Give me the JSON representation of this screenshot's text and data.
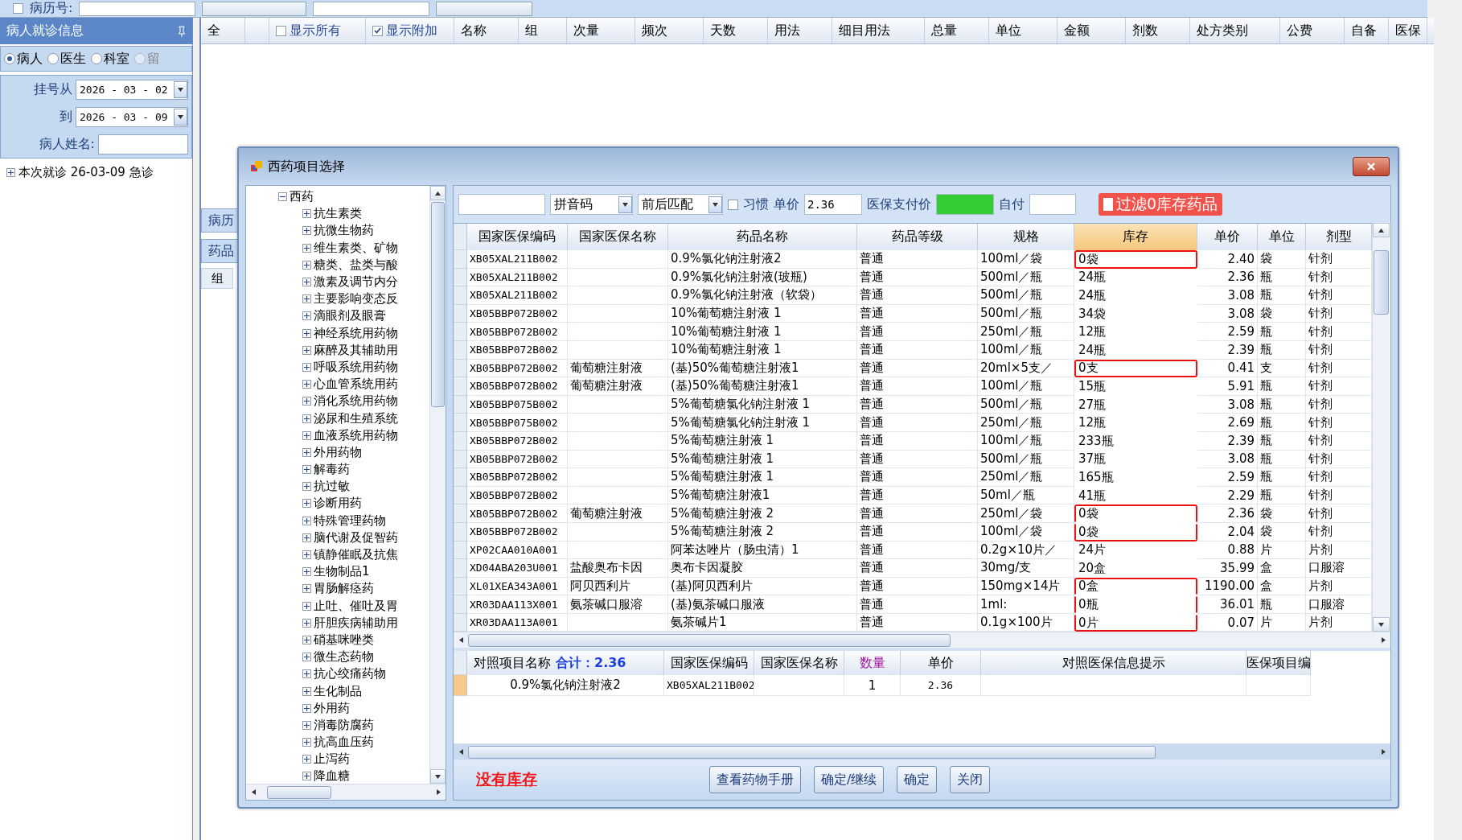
{
  "top_bar": {
    "record_checkbox": {
      "checked": false
    },
    "record_label": "病历号:"
  },
  "left_panel": {
    "title": "病人就诊信息",
    "filters": [
      {
        "label": "病人",
        "selected": true,
        "disabled": false
      },
      {
        "label": "医生",
        "selected": false,
        "disabled": false
      },
      {
        "label": "科室",
        "selected": false,
        "disabled": false
      },
      {
        "label": "留",
        "selected": false,
        "disabled": true
      }
    ],
    "date_from_label": "挂号从",
    "date_from": "2026 - 03 - 02",
    "date_to_label": "到",
    "date_to": "2026 - 03 - 09",
    "name_label": "病人姓名:",
    "visits": [
      {
        "label": "本次就诊 26-03-09 急诊",
        "expanded": false
      }
    ]
  },
  "order_grid": {
    "columns": [
      {
        "kind": "text",
        "label": "全"
      },
      {
        "kind": "blank"
      },
      {
        "kind": "check",
        "label": "显示所有",
        "checked": false
      },
      {
        "kind": "check",
        "label": "显示附加",
        "checked": true
      },
      {
        "kind": "text",
        "label": "名称"
      },
      {
        "kind": "text",
        "label": "组"
      },
      {
        "kind": "text",
        "label": "次量"
      },
      {
        "kind": "text",
        "label": "频次"
      },
      {
        "kind": "text",
        "label": "天数"
      },
      {
        "kind": "text",
        "label": "用法"
      },
      {
        "kind": "text",
        "label": "细目用法"
      },
      {
        "kind": "text",
        "label": "总量"
      },
      {
        "kind": "text",
        "label": "单位"
      },
      {
        "kind": "text",
        "label": "金额"
      },
      {
        "kind": "text",
        "label": "剂数"
      },
      {
        "kind": "text",
        "label": "处方类别"
      },
      {
        "kind": "text",
        "label": "公费"
      },
      {
        "kind": "text",
        "label": "自备"
      },
      {
        "kind": "text",
        "label": "医保"
      }
    ],
    "tabs": [
      "病历",
      "药品"
    ],
    "subgrid_column": "组"
  },
  "dialog": {
    "title": "西药项目选择",
    "tree": {
      "label": "西药",
      "expanded": true,
      "children": [
        {
          "label": "抗生素类",
          "expanded": false
        },
        {
          "label": "抗微生物药",
          "expanded": false
        },
        {
          "label": "维生素类、矿物",
          "expanded": false
        },
        {
          "label": "糖类、盐类与酸",
          "expanded": false
        },
        {
          "label": "激素及调节内分",
          "expanded": false
        },
        {
          "label": "主要影响变态反",
          "expanded": false
        },
        {
          "label": "滴眼剂及眼膏",
          "expanded": false
        },
        {
          "label": "神经系统用药物",
          "expanded": false
        },
        {
          "label": "麻醉及其辅助用",
          "expanded": false
        },
        {
          "label": "呼吸系统用药物",
          "expanded": false
        },
        {
          "label": "心血管系统用药",
          "expanded": false
        },
        {
          "label": "消化系统用药物",
          "expanded": false
        },
        {
          "label": "泌尿和生殖系统",
          "expanded": false
        },
        {
          "label": "血液系统用药物",
          "expanded": false
        },
        {
          "label": "外用药物",
          "expanded": false
        },
        {
          "label": "解毒药",
          "expanded": false
        },
        {
          "label": "抗过敏",
          "expanded": false
        },
        {
          "label": "诊断用药",
          "expanded": false
        },
        {
          "label": "特殊管理药物",
          "expanded": false
        },
        {
          "label": "脑代谢及促智药",
          "expanded": false
        },
        {
          "label": "镇静催眠及抗焦",
          "expanded": false
        },
        {
          "label": "生物制品1",
          "expanded": false
        },
        {
          "label": "胃肠解痉药",
          "expanded": false
        },
        {
          "label": "止吐、催吐及胃",
          "expanded": false
        },
        {
          "label": "肝胆疾病辅助用",
          "expanded": false
        },
        {
          "label": "硝基咪唑类",
          "expanded": false
        },
        {
          "label": "微生态药物",
          "expanded": false
        },
        {
          "label": "抗心绞痛药物",
          "expanded": false
        },
        {
          "label": "生化制品",
          "expanded": false
        },
        {
          "label": "外用药",
          "expanded": false
        },
        {
          "label": "消毒防腐药",
          "expanded": false
        },
        {
          "label": "抗高血压药",
          "expanded": false
        },
        {
          "label": "止泻药",
          "expanded": false
        },
        {
          "label": "降血糖",
          "expanded": false
        }
      ]
    },
    "toolbar": {
      "code_type": "拼音码",
      "match_mode": "前后匹配",
      "habit": {
        "label": "习惯",
        "checked": false
      },
      "price_label": "单价",
      "price": "2.36",
      "insurance_price_label": "医保支付价",
      "self_pay_label": "自付",
      "filter_zero_stock": {
        "label": "过滤0库存药品",
        "checked": false
      }
    },
    "table": {
      "columns": [
        {
          "label": "国家医保编码",
          "sorted": false
        },
        {
          "label": "国家医保名称",
          "sorted": false
        },
        {
          "label": "药品名称",
          "sorted": false
        },
        {
          "label": "药品等级",
          "sorted": false
        },
        {
          "label": "规格",
          "sorted": false
        },
        {
          "label": "库存",
          "sorted": true
        },
        {
          "label": "单价",
          "sorted": false
        },
        {
          "label": "单位",
          "sorted": false
        },
        {
          "label": "剂型",
          "sorted": false
        }
      ],
      "rows": [
        {
          "highlighted": true,
          "cells": [
            "XB05XAL211B002",
            "",
            "0.9%氯化钠注射液2",
            "普通",
            "100ml／袋",
            "0袋",
            "2.40",
            "袋",
            "针剂"
          ]
        },
        {
          "highlighted": false,
          "cells": [
            "XB05XAL211B002",
            "",
            "0.9%氯化钠注射液(玻瓶)",
            "普通",
            "500ml／瓶",
            "24瓶",
            "2.36",
            "瓶",
            "针剂"
          ]
        },
        {
          "highlighted": false,
          "cells": [
            "XB05XAL211B002",
            "",
            "0.9%氯化钠注射液（软袋）",
            "普通",
            "500ml／瓶",
            "24瓶",
            "3.08",
            "瓶",
            "针剂"
          ]
        },
        {
          "highlighted": false,
          "cells": [
            "XB05BBP072B002",
            "",
            "10%葡萄糖注射液 1",
            "普通",
            "500ml／瓶",
            "34袋",
            "3.08",
            "袋",
            "针剂"
          ]
        },
        {
          "highlighted": false,
          "cells": [
            "XB05BBP072B002",
            "",
            "10%葡萄糖注射液 1",
            "普通",
            "250ml／瓶",
            "12瓶",
            "2.59",
            "瓶",
            "针剂"
          ]
        },
        {
          "highlighted": false,
          "cells": [
            "XB05BBP072B002",
            "",
            "10%葡萄糖注射液 1",
            "普通",
            "100ml／瓶",
            "24瓶",
            "2.39",
            "瓶",
            "针剂"
          ]
        },
        {
          "highlighted": true,
          "cells": [
            "XB05BBP072B002",
            "葡萄糖注射液",
            "(基)50%葡萄糖注射液1",
            "普通",
            "20ml×5支／",
            "0支",
            "0.41",
            "支",
            "针剂"
          ]
        },
        {
          "highlighted": false,
          "cells": [
            "XB05BBP072B002",
            "葡萄糖注射液",
            "(基)50%葡萄糖注射液1",
            "普通",
            "100ml／瓶",
            "15瓶",
            "5.91",
            "瓶",
            "针剂"
          ]
        },
        {
          "highlighted": false,
          "cells": [
            "XB05BBP075B002",
            "",
            "5%葡萄糖氯化钠注射液 1",
            "普通",
            "500ml／瓶",
            "27瓶",
            "3.08",
            "瓶",
            "针剂"
          ]
        },
        {
          "highlighted": false,
          "cells": [
            "XB05BBP075B002",
            "",
            "5%葡萄糖氯化钠注射液 1",
            "普通",
            "250ml／瓶",
            "12瓶",
            "2.69",
            "瓶",
            "针剂"
          ]
        },
        {
          "highlighted": false,
          "cells": [
            "XB05BBP072B002",
            "",
            "5%葡萄糖注射液 1",
            "普通",
            "100ml／瓶",
            "233瓶",
            "2.39",
            "瓶",
            "针剂"
          ]
        },
        {
          "highlighted": false,
          "cells": [
            "XB05BBP072B002",
            "",
            "5%葡萄糖注射液 1",
            "普通",
            "500ml／瓶",
            "37瓶",
            "3.08",
            "瓶",
            "针剂"
          ]
        },
        {
          "highlighted": false,
          "cells": [
            "XB05BBP072B002",
            "",
            "5%葡萄糖注射液 1",
            "普通",
            "250ml／瓶",
            "165瓶",
            "2.59",
            "瓶",
            "针剂"
          ]
        },
        {
          "highlighted": false,
          "cells": [
            "XB05BBP072B002",
            "",
            "5%葡萄糖注射液1",
            "普通",
            "50ml／瓶",
            "41瓶",
            "2.29",
            "瓶",
            "针剂"
          ]
        },
        {
          "highlighted": true,
          "cells": [
            "XB05BBP072B002",
            "葡萄糖注射液",
            "5%葡萄糖注射液 2",
            "普通",
            "250ml／袋",
            "0袋",
            "2.36",
            "袋",
            "针剂"
          ]
        },
        {
          "highlighted": true,
          "cells": [
            "XB05BBP072B002",
            "",
            "5%葡萄糖注射液 2",
            "普通",
            "100ml／袋",
            "0袋",
            "2.04",
            "袋",
            "针剂"
          ]
        },
        {
          "highlighted": false,
          "cells": [
            "XP02CAA010A001",
            "",
            "阿苯达唑片（肠虫清）1",
            "普通",
            "0.2g×10片／",
            "24片",
            "0.88",
            "片",
            "片剂"
          ]
        },
        {
          "highlighted": false,
          "cells": [
            "XD04ABA203U001",
            "盐酸奥布卡因",
            "奥布卡因凝胶",
            "普通",
            "30mg/支",
            "20盒",
            "35.99",
            "盒",
            "口服溶"
          ]
        },
        {
          "highlighted": true,
          "cells": [
            "XL01XEA343A001",
            "阿贝西利片",
            "(基)阿贝西利片",
            "普通",
            "150mg×14片",
            "0盒",
            "1190.00",
            "盒",
            "片剂"
          ]
        },
        {
          "highlighted": true,
          "cells": [
            "XR03DAA113X001",
            "氨茶碱口服溶",
            "(基)氨茶碱口服液",
            "普通",
            "1ml:",
            "0瓶",
            "36.01",
            "瓶",
            "口服溶"
          ]
        },
        {
          "highlighted": true,
          "cells": [
            "XR03DAA113A001",
            "",
            "氨茶碱片1",
            "普通",
            "0.1g×100片",
            "0片",
            "0.07",
            "片",
            "片剂"
          ]
        }
      ]
    },
    "selected_grid": {
      "columns": [
        {
          "label": "对照项目名称",
          "color": "#000000"
        },
        {
          "label": "国家医保编码",
          "color": "#000000"
        },
        {
          "label": "国家医保名称",
          "color": "#000000"
        },
        {
          "label": "数量",
          "color": "#a0189c"
        },
        {
          "label": "单价",
          "color": "#000000"
        },
        {
          "label": "对照医保信息提示",
          "color": "#000000"
        },
        {
          "label": "医保项目编",
          "color": "#000000"
        }
      ],
      "total": "合计：2.36",
      "rows": [
        {
          "item_name": "0.9%氯化钠注射液2",
          "national_code": "XB05XAL211B002",
          "quantity": "1",
          "unit_price": "2.36"
        }
      ]
    },
    "status": "没有库存",
    "buttons": [
      "查看药物手册",
      "确定/继续",
      "确定",
      "关闭"
    ]
  }
}
